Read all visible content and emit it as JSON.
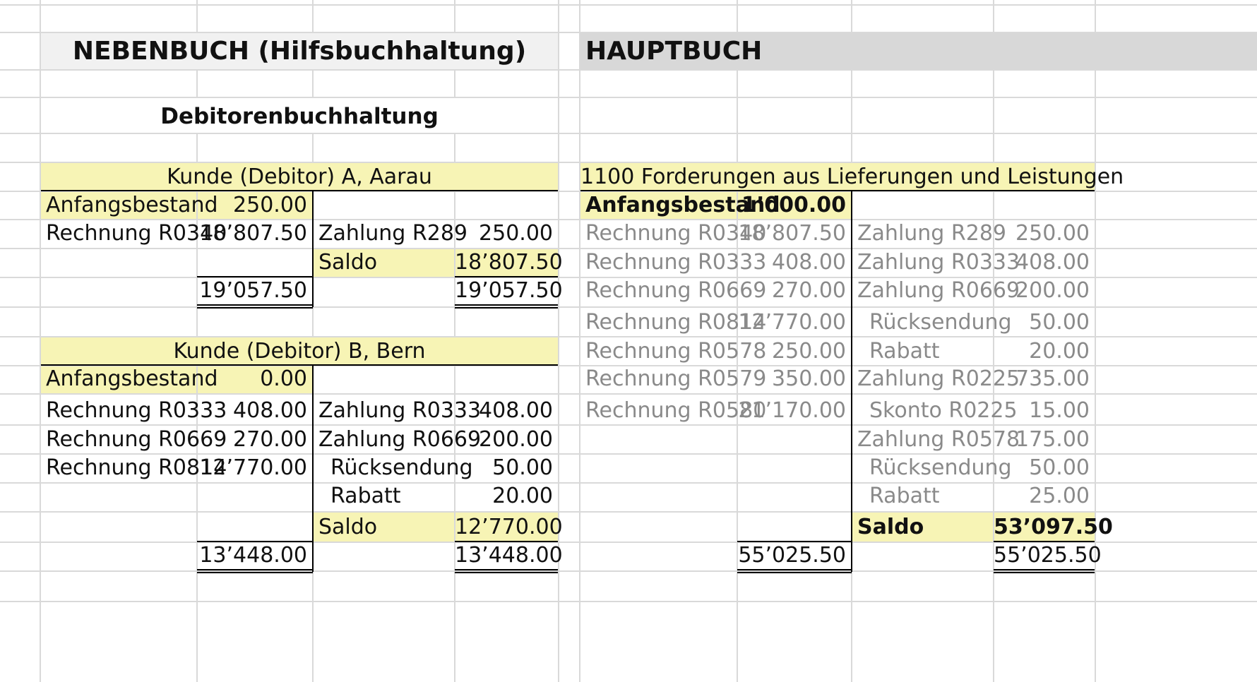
{
  "colors": {
    "yellow_fill": "#f7f4b5",
    "light_gray_fill": "#f1f1f1",
    "mid_gray_fill": "#d8d8d8",
    "gray_text": "#8a8a8a",
    "grid": "#d9d9d9"
  },
  "nebenbuch": {
    "title": "NEBENBUCH (Hilfsbuchhaltung)",
    "subtitle": "Debitorenbuchhaltung",
    "kunde_a": {
      "header": "Kunde (Debitor) A, Aarau",
      "opening_label": "Anfangsbestand",
      "opening_value": "250.00",
      "debit": [
        {
          "label": "Rechnung R0340",
          "amount": "18’807.50"
        }
      ],
      "credit": [
        {
          "label": "Zahlung R289",
          "amount": "250.00"
        }
      ],
      "saldo_label": "Saldo",
      "saldo_value": "18’807.50",
      "total_debit": "19’057.50",
      "total_credit": "19’057.50"
    },
    "kunde_b": {
      "header": "Kunde (Debitor) B, Bern",
      "opening_label": "Anfangsbestand",
      "opening_value": "0.00",
      "debit": [
        {
          "label": "Rechnung R0333",
          "amount": "408.00"
        },
        {
          "label": "Rechnung R0669",
          "amount": "270.00"
        },
        {
          "label": "Rechnung R0814",
          "amount": "12’770.00"
        }
      ],
      "credit": [
        {
          "label": "Zahlung R0333",
          "amount": "408.00"
        },
        {
          "label": "Zahlung R0669",
          "amount": "200.00"
        },
        {
          "label": "Rücksendung",
          "amount": "50.00"
        },
        {
          "label": "Rabatt",
          "amount": "20.00"
        }
      ],
      "saldo_label": "Saldo",
      "saldo_value": "12’770.00",
      "total_debit": "13’448.00",
      "total_credit": "13’448.00"
    }
  },
  "hauptbuch": {
    "title": "HAUPTBUCH",
    "account": {
      "header": "1100 Forderungen aus Lieferungen und Leistungen",
      "opening_label": "Anfangsbestand",
      "opening_value": "1’000.00",
      "debit": [
        {
          "label": "Rechnung R0340",
          "amount": "18’807.50"
        },
        {
          "label": "Rechnung R0333",
          "amount": "408.00"
        },
        {
          "label": "Rechnung R0669",
          "amount": "270.00"
        },
        {
          "label": "Rechnung R0814",
          "amount": "12’770.00"
        },
        {
          "label": "Rechnung R0578",
          "amount": "250.00"
        },
        {
          "label": "Rechnung R0579",
          "amount": "350.00"
        },
        {
          "label": "Rechnung R0580",
          "amount": "21’170.00"
        }
      ],
      "credit": [
        {
          "label": "Zahlung R289",
          "amount": "250.00"
        },
        {
          "label": "Zahlung R0333",
          "amount": "408.00"
        },
        {
          "label": "Zahlung R0669",
          "amount": "200.00"
        },
        {
          "label": "Rücksendung",
          "amount": "50.00"
        },
        {
          "label": "Rabatt",
          "amount": "20.00"
        },
        {
          "label": "Zahlung R0225",
          "amount": "735.00"
        },
        {
          "label": "Skonto R0225",
          "amount": "15.00"
        },
        {
          "label": "Zahlung R0578",
          "amount": "175.00"
        },
        {
          "label": "Rücksendung",
          "amount": "50.00"
        },
        {
          "label": "Rabatt",
          "amount": "25.00"
        }
      ],
      "saldo_label": "Saldo",
      "saldo_value": "53’097.50",
      "total_debit": "55’025.50",
      "total_credit": "55’025.50"
    }
  }
}
